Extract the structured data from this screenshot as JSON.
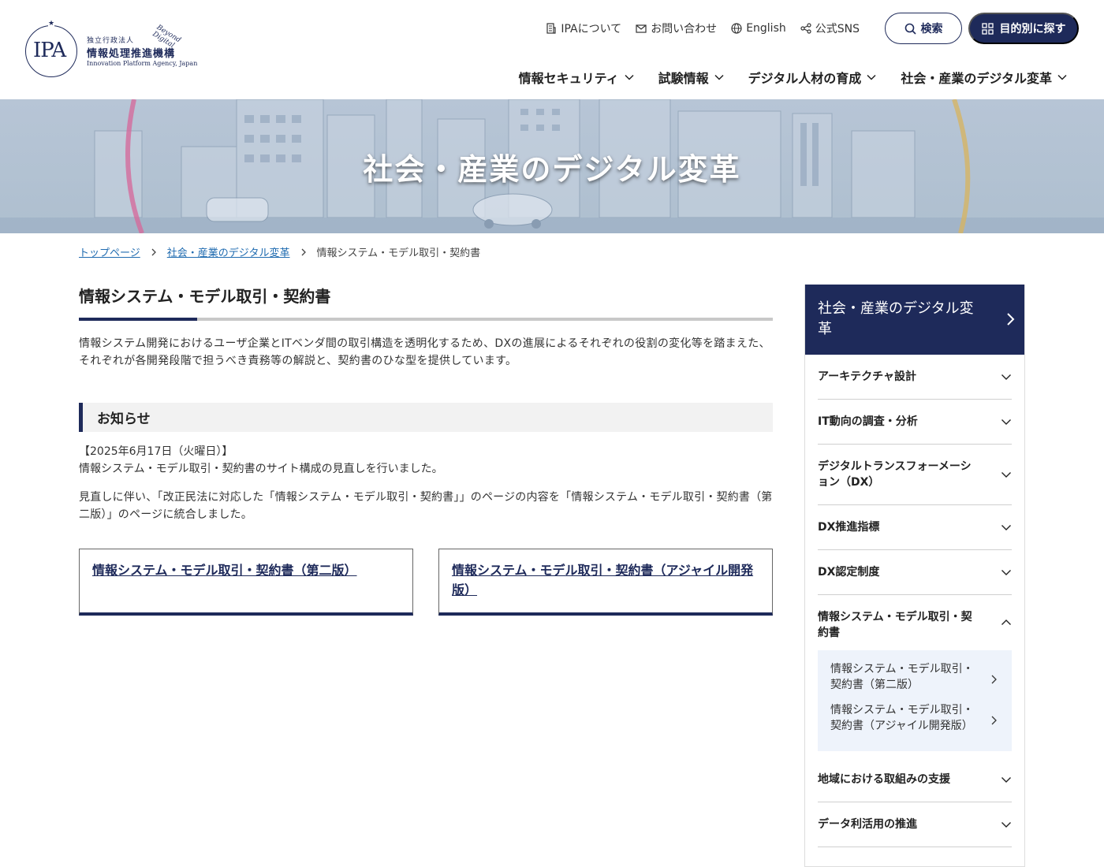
{
  "header": {
    "logo": {
      "top_small": "独立行政法人",
      "name": "情報処理推進機構",
      "english": "Innovation Platform Agency, Japan",
      "tagline": "Beyond Digital",
      "mark": "IPA"
    },
    "utility_nav": [
      {
        "label": "IPAについて",
        "icon": "building-icon"
      },
      {
        "label": "お問い合わせ",
        "icon": "mail-icon"
      },
      {
        "label": "English",
        "icon": "globe-icon"
      },
      {
        "label": "公式SNS",
        "icon": "share-icon"
      }
    ],
    "search_label": "検索",
    "purpose_label": "目的別に探す",
    "main_nav": [
      {
        "label": "情報セキュリティ"
      },
      {
        "label": "試験情報"
      },
      {
        "label": "デジタル人材の育成"
      },
      {
        "label": "社会・産業のデジタル変革"
      }
    ]
  },
  "hero": {
    "title": "社会・産業のデジタル変革"
  },
  "breadcrumb": [
    {
      "label": "トップページ"
    },
    {
      "label": "社会・産業のデジタル変革"
    },
    {
      "label": "情報システム・モデル取引・契約書"
    }
  ],
  "main": {
    "title": "情報システム・モデル取引・契約書",
    "lead": "情報システム開発におけるユーザ企業とITベンダ間の取引構造を透明化するため、DXの進展によるそれぞれの役割の変化等を踏まえた、それぞれが各開発段階で担うべき責務等の解説と、契約書のひな型を提供しています。",
    "notice_heading": "お知らせ",
    "notice_date": "【2025年6月17日（火曜日）】",
    "notice_line1": "情報システム・モデル取引・契約書のサイト構成の見直しを行いました。",
    "notice_line2": "見直しに伴い、「改正民法に対応した「情報システム・モデル取引・契約書」」のページの内容を「情報システム・モデル取引・契約書（第二版）」のページに統合しました。",
    "cards": [
      {
        "label": "情報システム・モデル取引・契約書（第二版）"
      },
      {
        "label": "情報システム・モデル取引・契約書（アジャイル開発版）"
      }
    ]
  },
  "sidebar": {
    "heading": "社会・産業のデジタル変革",
    "items": [
      {
        "label": "アーキテクチャ設計"
      },
      {
        "label": "IT動向の調査・分析"
      },
      {
        "label": "デジタルトランスフォーメーション（DX）"
      },
      {
        "label": "DX推進指標"
      },
      {
        "label": "DX認定制度"
      },
      {
        "label": "情報システム・モデル取引・契約書"
      },
      {
        "label": "地域における取組みの支援"
      },
      {
        "label": "データ利活用の推進"
      }
    ],
    "subitems": [
      {
        "label": "情報システム・モデル取引・契約書（第二版）"
      },
      {
        "label": "情報システム・モデル取引・契約書（アジャイル開発版）"
      }
    ]
  },
  "colors": {
    "navy": "#1e2a5a",
    "link": "#1f6bb0",
    "sub_bg": "#eef3fb"
  }
}
